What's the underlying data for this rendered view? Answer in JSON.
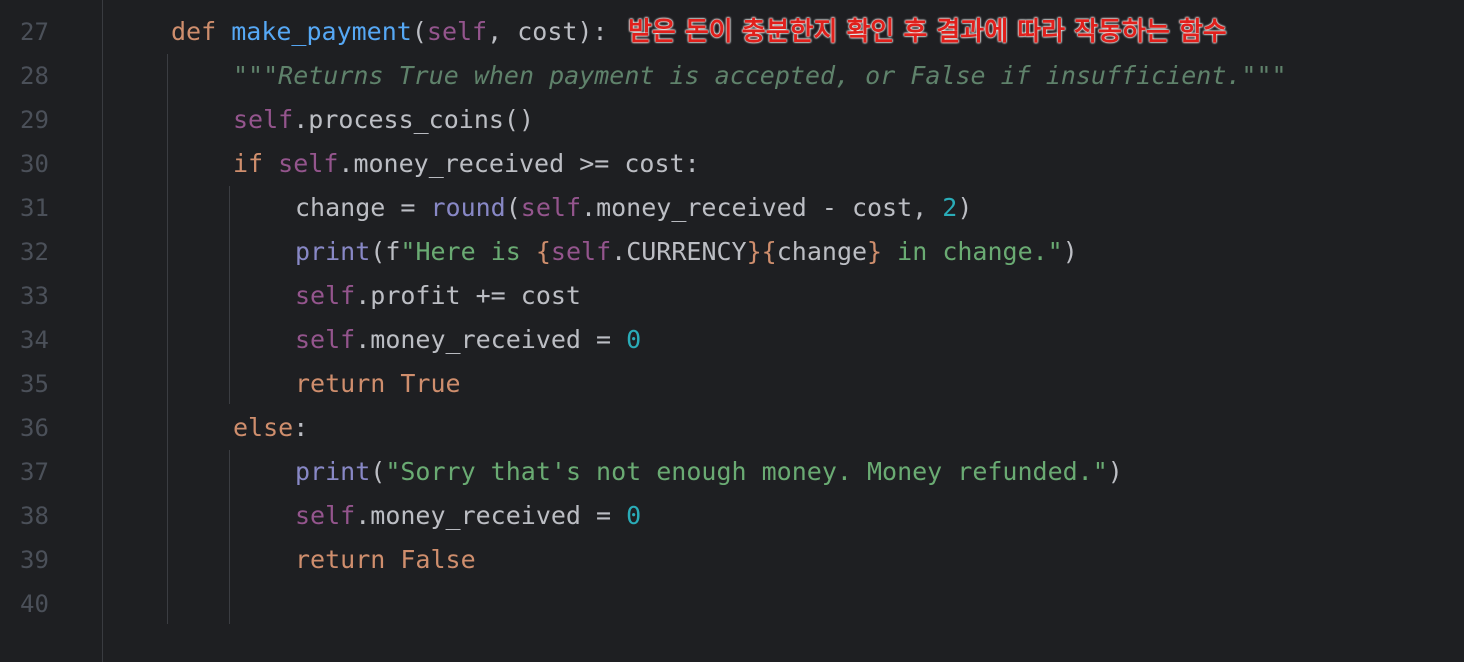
{
  "line_numbers": [
    "27",
    "28",
    "29",
    "30",
    "31",
    "32",
    "33",
    "34",
    "35",
    "36",
    "37",
    "38",
    "39",
    "40"
  ],
  "colors": {
    "background": "#1e1f22",
    "keyword": "#cf8e6d",
    "function": "#56a8f5",
    "self": "#94558d",
    "builtin": "#8888c6",
    "string": "#6aab73",
    "number": "#2aacb8",
    "docstring": "#5f826b",
    "annotation": "#e0201c"
  },
  "annotation": "받은 돈이 충분한지 확인 후 결과에 따라 작동하는 함수",
  "code": {
    "l27": {
      "def": "def",
      "name": "make_payment",
      "open": "(",
      "self": "self",
      "rest": ", cost):"
    },
    "l28": {
      "doc": "\"\"\"Returns True when payment is accepted, or False if insufficient.\"\"\""
    },
    "l29": {
      "self": "self",
      "rest": ".process_coins()"
    },
    "l30": {
      "if": "if",
      "self": "self",
      "rest": ".money_received >= cost:"
    },
    "l31": {
      "a": "change = ",
      "round": "round",
      "b": "(",
      "self": "self",
      "c": ".money_received - cost, ",
      "num": "2",
      "d": ")"
    },
    "l32": {
      "print": "print",
      "a": "(",
      "f": "f",
      "s1": "\"Here is ",
      "b1": "{",
      "self": "self",
      "m": ".CURRENCY",
      "b2": "}",
      "b3": "{",
      "v": "change",
      "b4": "}",
      "s2": " in change.\"",
      "end": ")"
    },
    "l33": {
      "self": "self",
      "rest": ".profit += cost"
    },
    "l34": {
      "self": "self",
      "rest": ".money_received = ",
      "num": "0"
    },
    "l35": {
      "return": "return",
      "sp": " ",
      "val": "True"
    },
    "l36": {
      "else": "else",
      "rest": ":"
    },
    "l37": {
      "print": "print",
      "a": "(",
      "str": "\"Sorry that's not enough money. Money refunded.\"",
      "end": ")"
    },
    "l38": {
      "self": "self",
      "rest": ".money_received = ",
      "num": "0"
    },
    "l39": {
      "return": "return",
      "sp": " ",
      "val": "False"
    }
  }
}
